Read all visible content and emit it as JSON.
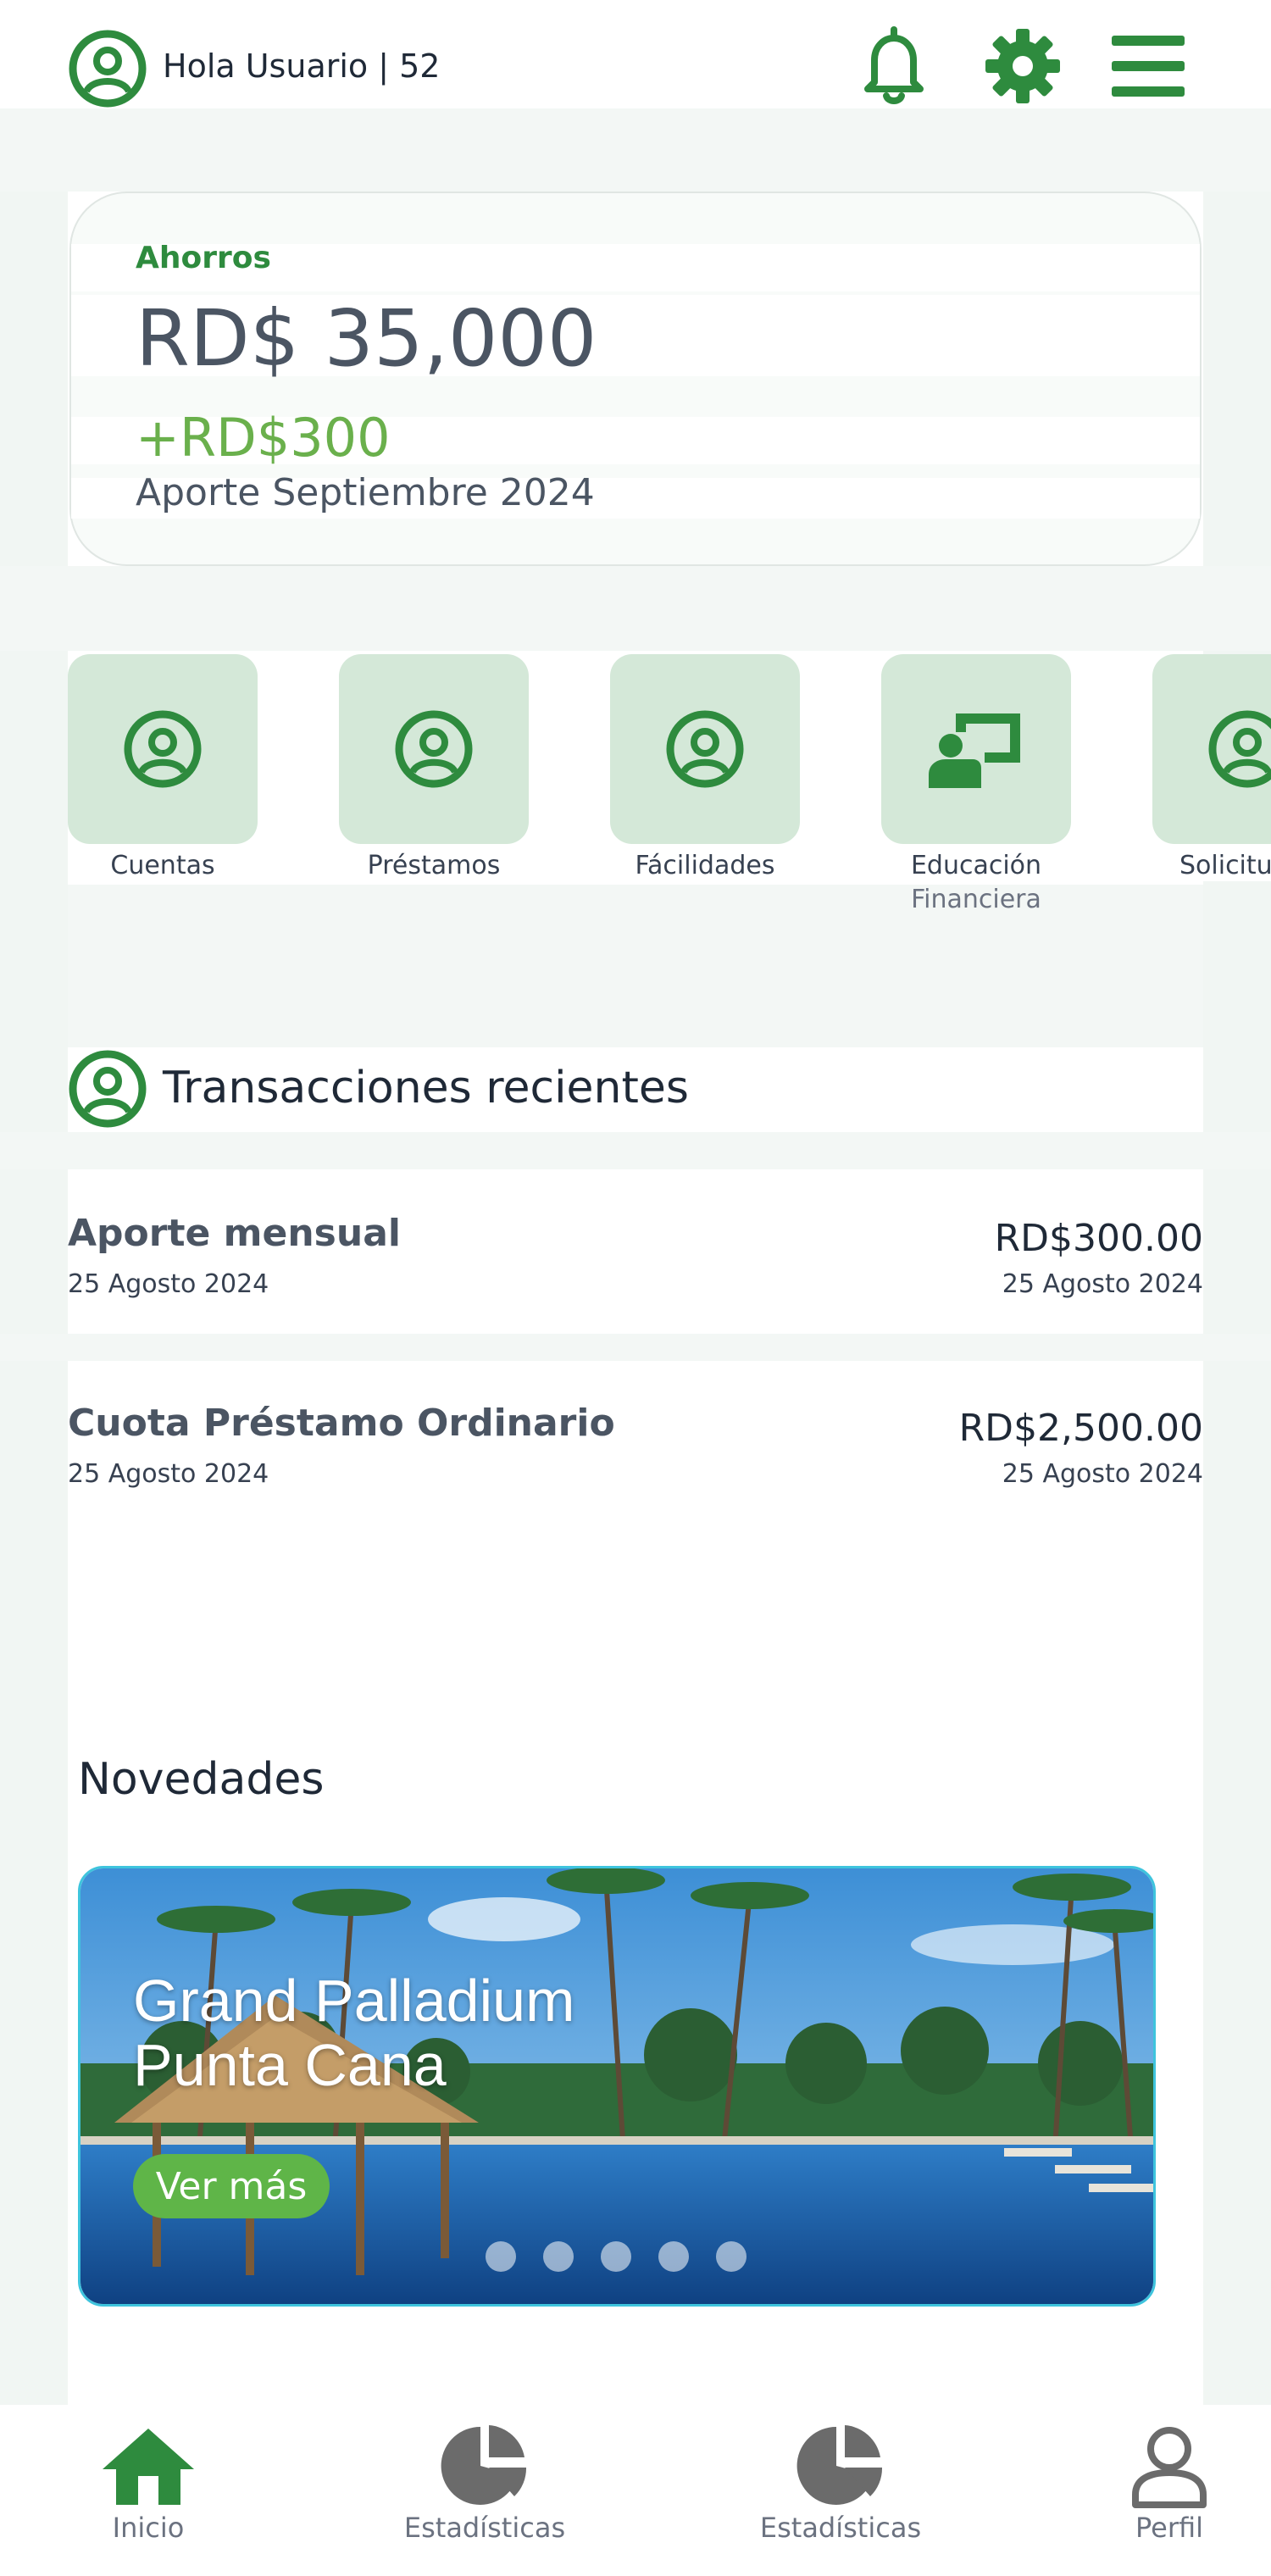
{
  "header": {
    "greeting": "Hola Usuario | 52",
    "icons": [
      "user-circle-icon",
      "bell-icon",
      "gear-icon",
      "menu-icon"
    ]
  },
  "savings_card": {
    "label": "Ahorros",
    "amount": "RD$ 35,000",
    "contribution": "+RD$300",
    "contribution_note": "Aporte Septiembre 2024"
  },
  "quick_access": [
    {
      "label": "Cuentas",
      "sublabel": "",
      "icon": "user-circle-icon"
    },
    {
      "label": "Préstamos",
      "sublabel": "",
      "icon": "user-circle-icon"
    },
    {
      "label": "Fácilidades",
      "sublabel": "",
      "icon": "user-circle-icon"
    },
    {
      "label": "Educación",
      "sublabel": "Financiera",
      "icon": "teacher-board-icon"
    },
    {
      "label": "Solicitu",
      "sublabel": "",
      "icon": "user-circle-icon"
    }
  ],
  "transactions": {
    "title": "Transacciones recientes",
    "items": [
      {
        "name": "Aporte mensual",
        "date": "25 Agosto 2024",
        "amount": "RD$300.00",
        "date_right": "25 Agosto 2024"
      },
      {
        "name": "Cuota Préstamo Ordinario",
        "date": "25 Agosto 2024",
        "amount": "RD$2,500.00",
        "date_right": "25 Agosto 2024"
      }
    ]
  },
  "news": {
    "title": "Novedades",
    "banner": {
      "title_line1": "Grand Palladium",
      "title_line2": "Punta Cana",
      "button_label": "Ver más",
      "slide_count": 5
    }
  },
  "bottom_nav": [
    {
      "label": "Inicio",
      "icon": "home-icon",
      "active": true
    },
    {
      "label": "Estadísticas",
      "icon": "pie-chart-icon",
      "active": false
    },
    {
      "label": "Estadísticas",
      "icon": "pie-chart-icon",
      "active": false
    },
    {
      "label": "Perfil",
      "icon": "profile-icon",
      "active": false
    }
  ],
  "colors": {
    "brand_green": "#2e8b3e",
    "accent_green": "#6ab04c",
    "tile_bg": "#d4e8d8",
    "banner_border": "#3ec4dd"
  }
}
